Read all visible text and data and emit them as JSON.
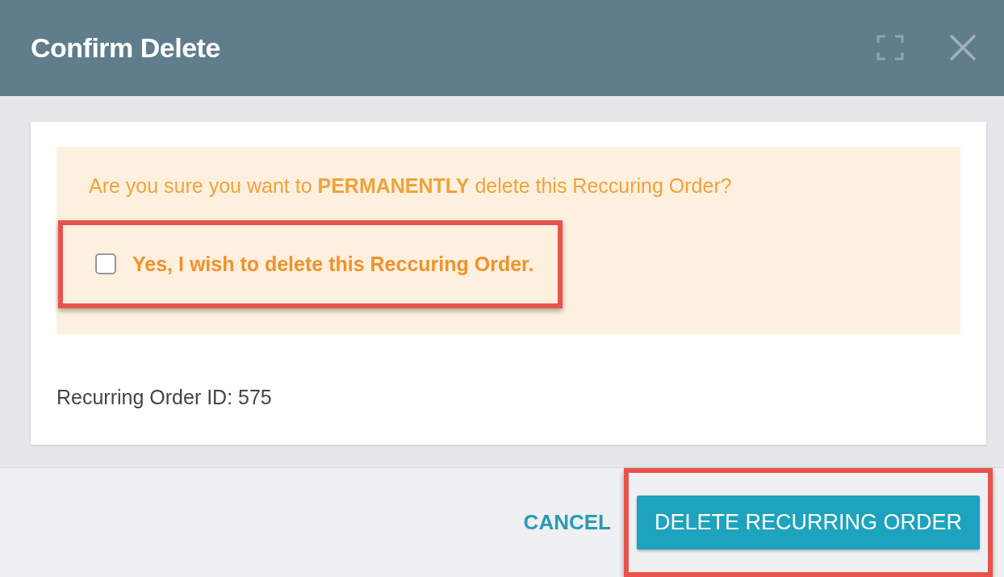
{
  "dialog": {
    "title": "Confirm Delete"
  },
  "warning": {
    "message": "Are you sure you want to **PERMANENTLY** delete this Reccuring Order?",
    "confirm": {
      "label": "Yes, I wish to delete this Reccuring Order.",
      "checked": false,
      "highlighted": true
    }
  },
  "details": "Recurring Order ID: 575",
  "buttons": [
    {
      "label": "CANCEL",
      "kind": "link",
      "highlighted": false
    },
    {
      "label": "DELETE RECURRING ORDER",
      "kind": "primary",
      "highlighted": true
    }
  ]
}
